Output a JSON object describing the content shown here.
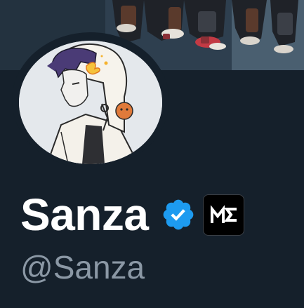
{
  "profile": {
    "display_name": "Sanza",
    "handle": "@Sanza",
    "verified": true,
    "affiliation_badge_icon": "me-logo-icon"
  },
  "icons": {
    "verified": "verified-check-icon",
    "affiliation": "me-logo-icon"
  },
  "colors": {
    "background": "#15202b",
    "name": "#ffffff",
    "handle": "#8b98a5",
    "verified_blue": "#1d9bf0",
    "affiliation_badge": "#000000"
  }
}
